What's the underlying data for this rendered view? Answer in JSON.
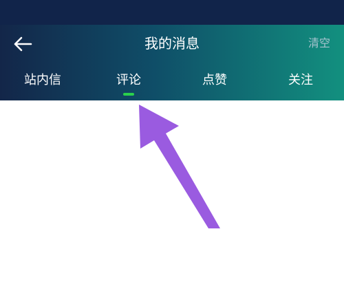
{
  "header": {
    "title": "我的消息",
    "clear_label": "清空",
    "back_icon": "arrow-left-icon"
  },
  "tabs": [
    {
      "label": "站内信",
      "active": false
    },
    {
      "label": "评论",
      "active": true
    },
    {
      "label": "点赞",
      "active": false
    },
    {
      "label": "关注",
      "active": false
    }
  ],
  "colors": {
    "status_bar": "#11244a",
    "header_start": "#132649",
    "header_end": "#12907f",
    "active_indicator": "#2bd14c",
    "annotation_arrow": "#9a5be0",
    "clear_text": "#a9c4cf"
  }
}
